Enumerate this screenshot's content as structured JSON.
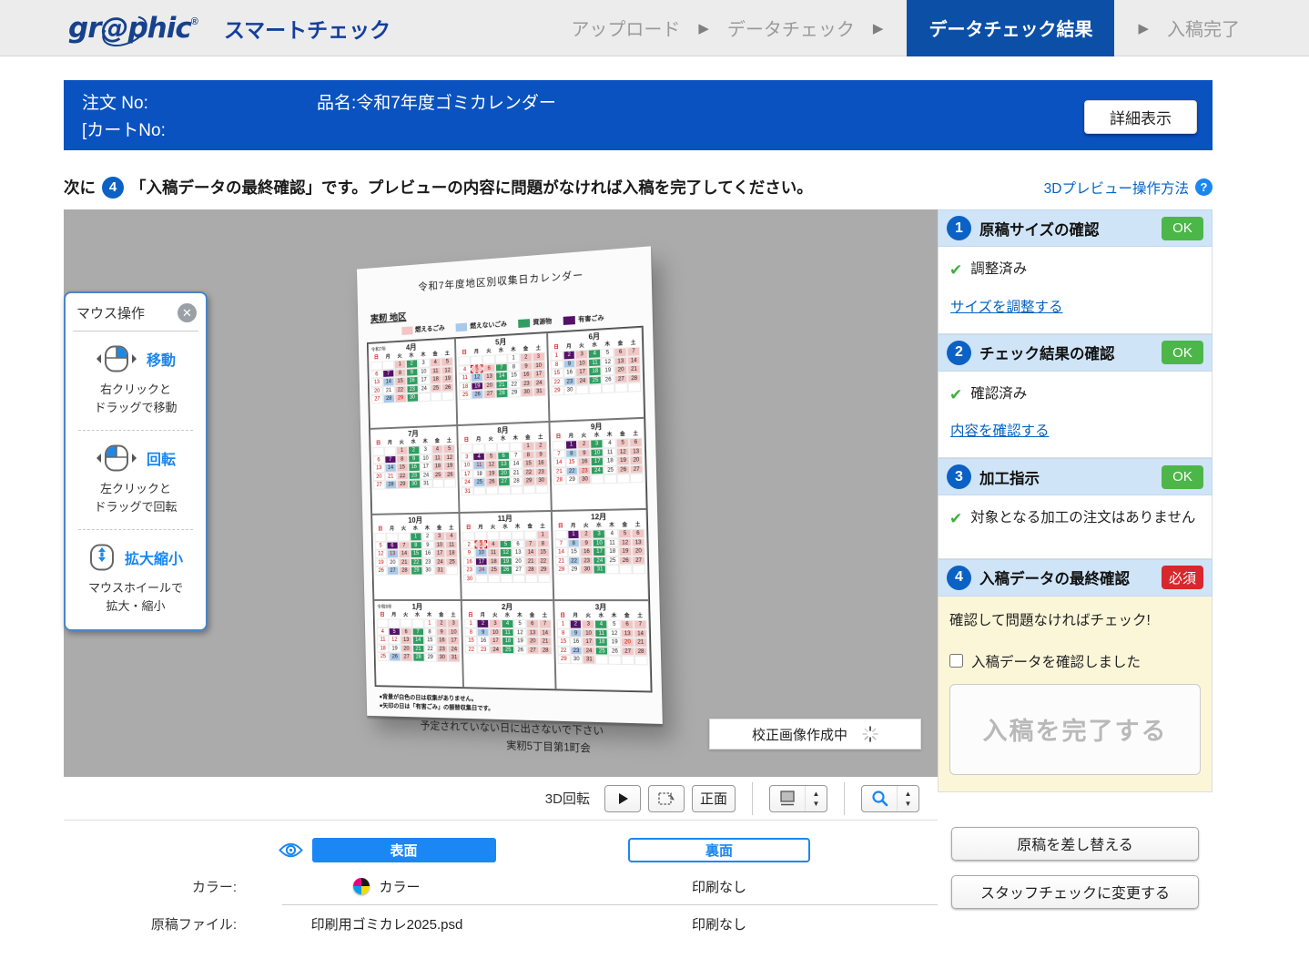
{
  "header": {
    "logo_text": "gr@phic",
    "logo_mark": "®",
    "app_name": "スマートチェック",
    "step_arrow": "▶",
    "steps": [
      "アップロード",
      "データチェック",
      "データチェック結果",
      "入稿完了"
    ],
    "active_step": "データチェック結果"
  },
  "order_bar": {
    "order_no_label": "注文 No:",
    "product": "品名:令和7年度ゴミカレンダー",
    "cart_no_label": "[カートNo:",
    "detail_button": "詳細表示"
  },
  "instruction": {
    "prefix": "次に",
    "step_number": "4",
    "body": "「入稿データの最終確認」です。プレビューの内容に問題がなければ入稿を完了してください。",
    "help_link": "3Dプレビュー操作方法",
    "help_glyph": "?"
  },
  "mouse_panel": {
    "title": "マウス操作",
    "close_glyph": "✕",
    "items": [
      {
        "label": "移動",
        "desc1": "右クリックと",
        "desc2": "ドラッグで移動"
      },
      {
        "label": "回転",
        "desc1": "左クリックと",
        "desc2": "ドラッグで回転"
      },
      {
        "label": "拡大縮小",
        "desc1": "マウスホイールで",
        "desc2": "拡大・縮小"
      }
    ]
  },
  "preview": {
    "status_text": "校正画像作成中"
  },
  "calendar": {
    "title": "令和7年度地区別収集日カレンダー",
    "district": "実籾 地区",
    "legend": [
      {
        "label": "燃えるごみ",
        "color": "#f2c6c4"
      },
      {
        "label": "燃えないごみ",
        "color": "#a9c9ea"
      },
      {
        "label": "資源物",
        "color": "#2f9e60"
      },
      {
        "label": "有害ごみ",
        "color": "#541168"
      }
    ],
    "weekdays": [
      "日",
      "月",
      "火",
      "水",
      "木",
      "金",
      "土"
    ],
    "pink_weekdays": [
      2,
      5,
      6
    ],
    "green_weekday": 3,
    "months": [
      {
        "name": "4月",
        "era": "令和7年",
        "first": 2,
        "days": 30,
        "purple": [
          7
        ],
        "blue": [
          14,
          28
        ],
        "red": [
          29
        ]
      },
      {
        "name": "5月",
        "first": 4,
        "days": 31,
        "purple": [
          19
        ],
        "blue": [
          12,
          26
        ],
        "red": [
          3,
          4,
          5,
          6
        ],
        "dashed": [
          5
        ]
      },
      {
        "name": "6月",
        "first": 0,
        "days": 30,
        "purple": [
          2
        ],
        "blue": [
          9,
          23
        ],
        "red": []
      },
      {
        "name": "7月",
        "first": 2,
        "days": 31,
        "purple": [
          7
        ],
        "blue": [
          14,
          28
        ],
        "red": [
          21
        ]
      },
      {
        "name": "8月",
        "first": 5,
        "days": 31,
        "purple": [
          4
        ],
        "blue": [
          11,
          25
        ],
        "red": [
          11
        ]
      },
      {
        "name": "9月",
        "first": 1,
        "days": 30,
        "purple": [
          1
        ],
        "blue": [
          8,
          22
        ],
        "red": [
          15,
          23
        ]
      },
      {
        "name": "10月",
        "first": 3,
        "days": 31,
        "purple": [
          6
        ],
        "blue": [
          13,
          27
        ],
        "red": [
          13
        ]
      },
      {
        "name": "11月",
        "first": 6,
        "days": 30,
        "purple": [
          17
        ],
        "blue": [
          10,
          24
        ],
        "red": [
          3,
          23,
          24
        ],
        "dashed": [
          3
        ]
      },
      {
        "name": "12月",
        "first": 1,
        "days": 31,
        "purple": [
          1
        ],
        "blue": [
          8,
          22
        ],
        "red": []
      },
      {
        "name": "1月",
        "era": "令和8年",
        "first": 4,
        "days": 31,
        "purple": [
          5
        ],
        "blue": [
          26
        ],
        "red": [
          1,
          12
        ]
      },
      {
        "name": "2月",
        "first": 0,
        "days": 28,
        "purple": [
          2
        ],
        "blue": [
          9
        ],
        "red": [
          11,
          23
        ]
      },
      {
        "name": "3月",
        "first": 0,
        "days": 31,
        "purple": [
          2
        ],
        "blue": [
          9,
          23
        ],
        "red": [
          20
        ]
      }
    ],
    "notes": [
      "●背景が白色の日は収集がありません。",
      "●矢印の日は「有害ごみ」の振替収集日です。"
    ],
    "warning": "予定されていない日に出さないで下さい",
    "organization": "実籾5丁目第1町会"
  },
  "toolbar": {
    "rotate_label": "3D回転",
    "front_button": "正面"
  },
  "compare": {
    "front_tab": "表面",
    "back_tab": "裏面",
    "color_row": {
      "label": "カラー:",
      "front_value": "カラー",
      "back_value": "印刷なし"
    },
    "file_row": {
      "label": "原稿ファイル:",
      "front_value": "印刷用ゴミカレ2025.psd",
      "back_value": "印刷なし"
    }
  },
  "sidebar": {
    "sections": [
      {
        "num": "1",
        "title": "原稿サイズの確認",
        "badge": "OK",
        "check_text": "調整済み",
        "link": "サイズを調整する"
      },
      {
        "num": "2",
        "title": "チェック結果の確認",
        "badge": "OK",
        "check_text": "確認済み",
        "link": "内容を確認する"
      },
      {
        "num": "3",
        "title": "加工指示",
        "badge": "OK",
        "check_text": "対象となる加工の注文はありません"
      },
      {
        "num": "4",
        "title": "入稿データの最終確認",
        "badge": "必須",
        "confirm_text": "確認して問題なければチェック!",
        "checkbox_label": "入稿データを確認しました",
        "submit_button": "入稿を完了する"
      }
    ],
    "replace_button": "原稿を差し替える",
    "staff_button": "スタッフチェックに変更する"
  },
  "colors": {
    "brand_blue": "#16418c",
    "bar_blue": "#0a52c0",
    "active_tab_blue": "#0b4fa6",
    "accent_blue": "#1a86f0",
    "link_blue": "#0563c1",
    "ok_green": "#4cb748",
    "required_red": "#d7282d",
    "check_green": "#3fae3f",
    "preview_gray": "#ababab",
    "section_head_blue": "#cfe4f7",
    "yellow_bg": "#fbf6d8"
  }
}
